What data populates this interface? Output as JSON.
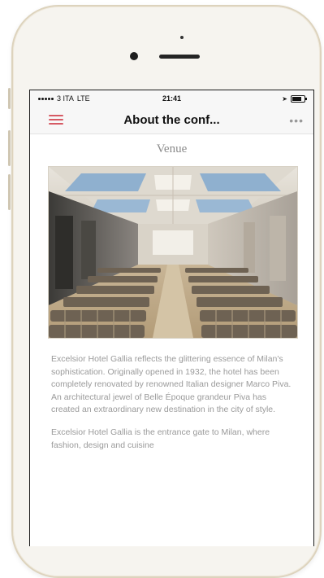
{
  "status_bar": {
    "carrier": "3 ITA",
    "network": "LTE",
    "time": "21:41"
  },
  "nav": {
    "title": "About the conf...",
    "more": "•••"
  },
  "section": {
    "heading": "Venue"
  },
  "paragraphs": [
    "Excelsior Hotel Gallia reflects the glittering essence of Milan's sophistication. Originally opened in 1932, the hotel has been completely renovated by renowned Italian designer Marco Piva. An architectural jewel of Belle Époque grandeur Piva has created an extraordinary new destination in the city of style.",
    "Excelsior Hotel Gallia is the entrance gate to Milan, where fashion, design and cuisine"
  ],
  "colors": {
    "accent": "#d65a64",
    "body_text": "#9a9a9a",
    "phone_frame": "#ddd3bd"
  }
}
